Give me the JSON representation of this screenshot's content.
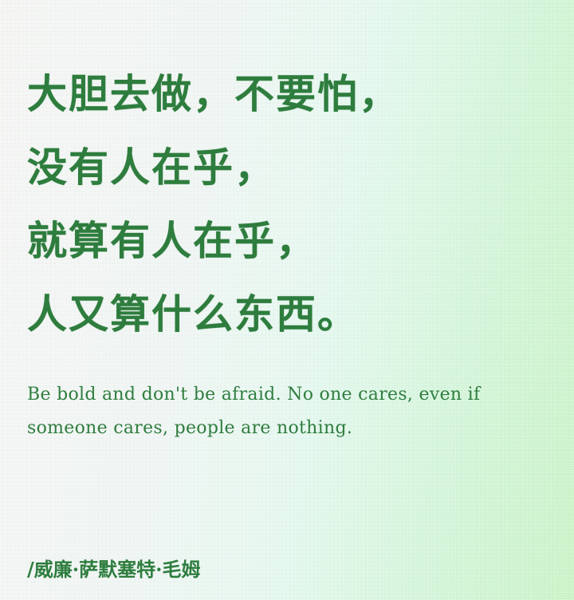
{
  "poem": {
    "lines": [
      "大胆去做，不要怕，",
      "没有人在乎，",
      "就算有人在乎，",
      "人又算什么东西。"
    ]
  },
  "translation": "Be bold and don't be afraid. No one cares, even if someone cares, people are nothing.",
  "author": "/威廉·萨默塞特·毛姆",
  "colors": {
    "text": "#2e7d3e",
    "background_left": "#f4f5f3",
    "background_right": "#c8f2c4"
  }
}
